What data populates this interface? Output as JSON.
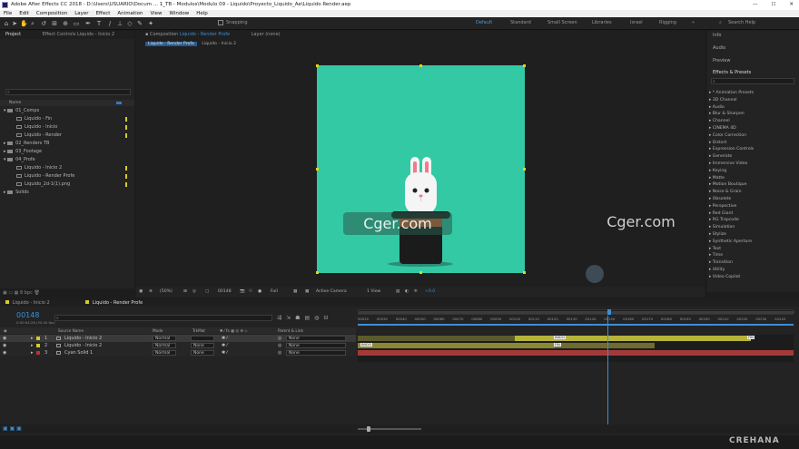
{
  "titlebar": {
    "title": "Adobe After Effects CC 2018 - D:\\Users\\USUARIO\\Docum ... 1_TB - Modulos\\Modulo 09 - Liquido\\Proyecto_Liquido_Ae\\Liquido Render.aep",
    "minimize": "—",
    "maximize": "☐",
    "close": "✕"
  },
  "menu": [
    "File",
    "Edit",
    "Composition",
    "Layer",
    "Effect",
    "Animation",
    "View",
    "Window",
    "Help"
  ],
  "toolbar": {
    "snapping": "Snapping",
    "search_help": "Search Help",
    "workspaces": [
      "Default",
      "Standard",
      "Small Screen",
      "Libraries",
      "Israel",
      "Rigging"
    ]
  },
  "project_panel": {
    "tab": "Project",
    "effect_controls_tab": "Effect Controls Liquido - Inicio 2",
    "column_name": "Name",
    "items": [
      {
        "label": "01_Comps",
        "type": "folder",
        "open": true,
        "indent": 0
      },
      {
        "label": "Liquido - Fin",
        "type": "comp",
        "indent": 1
      },
      {
        "label": "Liquido - Inicio",
        "type": "comp",
        "indent": 1
      },
      {
        "label": "Liquido - Render",
        "type": "comp",
        "indent": 1
      },
      {
        "label": "02_Renders TB",
        "type": "folder",
        "open": false,
        "indent": 0
      },
      {
        "label": "03_Footage",
        "type": "folder",
        "open": false,
        "indent": 0
      },
      {
        "label": "04_Profe",
        "type": "folder",
        "open": true,
        "indent": 0
      },
      {
        "label": "Liquido - Inicio 2",
        "type": "comp",
        "indent": 1
      },
      {
        "label": "Liquido - Render Profe",
        "type": "comp",
        "indent": 1
      },
      {
        "label": "Liquido_2d-1(1).png",
        "type": "file",
        "indent": 1
      },
      {
        "label": "Solids",
        "type": "folder",
        "open": false,
        "indent": 0
      }
    ],
    "bpc": "8 bpc"
  },
  "composition_panel": {
    "tab_label": "Composition",
    "tab_comp": "Liquido - Render Profe",
    "layer_tab": "Layer (none)",
    "breadcrumbs": [
      "Liquido - Render Profe",
      "Liquido - Inicio 2"
    ],
    "bg_color": "#33c9a5",
    "watermark_left": "Cger.com",
    "watermark_right": "Cger.com",
    "zoom": "(50%)",
    "timecode": "00148",
    "resolution": "Full",
    "camera": "Active Camera",
    "view": "1 View",
    "offset": "+0.0"
  },
  "right_panels": {
    "info": "Info",
    "audio": "Audio",
    "preview": "Preview",
    "effects_title": "Effects & Presets",
    "effects": [
      "* Animation Presets",
      "3D Channel",
      "Audio",
      "Blur & Sharpen",
      "Channel",
      "CINEMA 4D",
      "Color Correction",
      "Distort",
      "Expression Controls",
      "Generate",
      "Immersive Video",
      "Keying",
      "Matte",
      "Motion Boutique",
      "Noise & Grain",
      "Obsolete",
      "Perspective",
      "Red Giant",
      "RG Trapcode",
      "Simulation",
      "Stylize",
      "Synthetic Aperture",
      "Text",
      "Time",
      "Transition",
      "Utility",
      "Video Copilot"
    ]
  },
  "timeline": {
    "tabs": [
      "Liquido - Inicio 2",
      "Liquido - Render Profe"
    ],
    "timecode": "00148",
    "timecode_sub": "0:00:04:28 (30.00 fps)",
    "columns": {
      "source_name": "Source Name",
      "mode": "Mode",
      "trkmat": "TrkMat",
      "parent": "Parent & Link"
    },
    "layers": [
      {
        "num": "1",
        "name": "Liquido - Inicio 2",
        "mode": "Normal",
        "trkmat": "",
        "parent": "None",
        "label_color": "#d8c92c",
        "selected": true
      },
      {
        "num": "2",
        "name": "Liquido - Inicio 2",
        "mode": "Normal",
        "trkmat": "None",
        "parent": "None",
        "label_color": "#d8c92c",
        "selected": false
      },
      {
        "num": "3",
        "name": "Cyan Solid 1",
        "mode": "Normal",
        "trkmat": "None",
        "parent": "None",
        "label_color": "#c03030",
        "selected": false
      }
    ],
    "ruler": [
      "00020",
      "00030",
      "00040",
      "00050",
      "00060",
      "00070",
      "00080",
      "00090",
      "00100",
      "00110",
      "00120",
      "00130",
      "00140",
      "00150",
      "00160",
      "00170",
      "00180",
      "00190",
      "00200",
      "00210",
      "00220",
      "00230",
      "00240"
    ],
    "markers": {
      "inicio": "INICIO",
      "fin": "FIN"
    },
    "playhead_frame": 148
  },
  "watermark": "CREHANA",
  "colors": {
    "accent": "#2d8ceb",
    "layer_yellow": "#b7b33a",
    "layer_red": "#a33a3a",
    "comp_bg": "#33c9a5"
  }
}
